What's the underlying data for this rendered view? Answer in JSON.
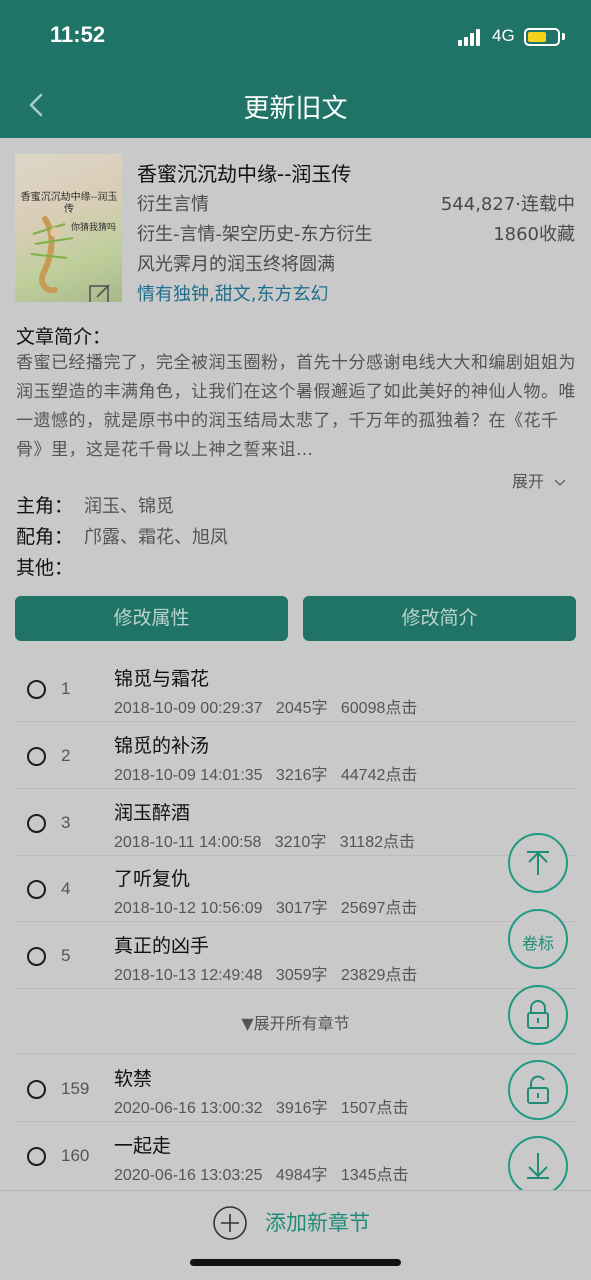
{
  "status": {
    "time": "11:52",
    "network": "4G"
  },
  "nav": {
    "title": "更新旧文"
  },
  "book": {
    "cover_title": "香蜜沉沉劫中缘--润玉传",
    "cover_author": "你猜我猜吗",
    "title": "香蜜沉沉劫中缘--润玉传",
    "genre": "衍生言情",
    "words_status": "544,827·连载中",
    "category": "衍生-言情-架空历史-东方衍生",
    "favorites": "1860收藏",
    "tagline": "风光霁月的润玉终将圆满",
    "tags": "情有独钟,甜文,东方玄幻"
  },
  "synopsis": {
    "label": "文章简介：",
    "text": "香蜜已经播完了，完全被润玉圈粉，首先十分感谢电线大大和编剧姐姐为润玉塑造的丰满角色，让我们在这个暑假邂逅了如此美好的神仙人物。唯一遗憾的，就是原书中的润玉结局太悲了，千万年的孤独着？在《花千骨》里，这是花千骨以上神之誓来诅…",
    "expand": "展开"
  },
  "roles": [
    {
      "label": "主角：",
      "value": "润玉、锦觅"
    },
    {
      "label": "配角：",
      "value": "邝露、霜花、旭凤"
    },
    {
      "label": "其他：",
      "value": ""
    }
  ],
  "buttons": {
    "edit_attributes": "修改属性",
    "edit_synopsis": "修改简介"
  },
  "chapters": [
    {
      "num": "1",
      "title": "锦觅与霜花",
      "date": "2018-10-09 00:29:37",
      "words": "2045字",
      "clicks": "60098点击"
    },
    {
      "num": "2",
      "title": "锦觅的补汤",
      "date": "2018-10-09 14:01:35",
      "words": "3216字",
      "clicks": "44742点击"
    },
    {
      "num": "3",
      "title": "润玉醉酒",
      "date": "2018-10-11 14:00:58",
      "words": "3210字",
      "clicks": "31182点击"
    },
    {
      "num": "4",
      "title": "了听复仇",
      "date": "2018-10-12 10:56:09",
      "words": "3017字",
      "clicks": "25697点击"
    },
    {
      "num": "5",
      "title": "真正的凶手",
      "date": "2018-10-13 12:49:48",
      "words": "3059字",
      "clicks": "23829点击"
    }
  ],
  "expand_all": "▼展开所有章节",
  "latest_chapters": [
    {
      "num": "159",
      "title": "软禁",
      "date": "2020-06-16 13:00:32",
      "words": "3916字",
      "clicks": "1507点击"
    },
    {
      "num": "160",
      "title": "一起走",
      "date": "2020-06-16 13:03:25",
      "words": "4984字",
      "clicks": "1345点击"
    }
  ],
  "fab": {
    "volume_label": "卷标"
  },
  "footer": {
    "add_chapter": "添加新章节"
  },
  "colors": {
    "primary": "#1f7467",
    "accent": "#1f8c78",
    "tag": "#1e6e8c",
    "overlay_bg": "#c9c9c9"
  },
  "icons": [
    "back-icon",
    "edit-icon",
    "scroll-top-icon",
    "lock-icon",
    "unlock-icon",
    "scroll-bottom-icon",
    "add-circle-icon"
  ]
}
